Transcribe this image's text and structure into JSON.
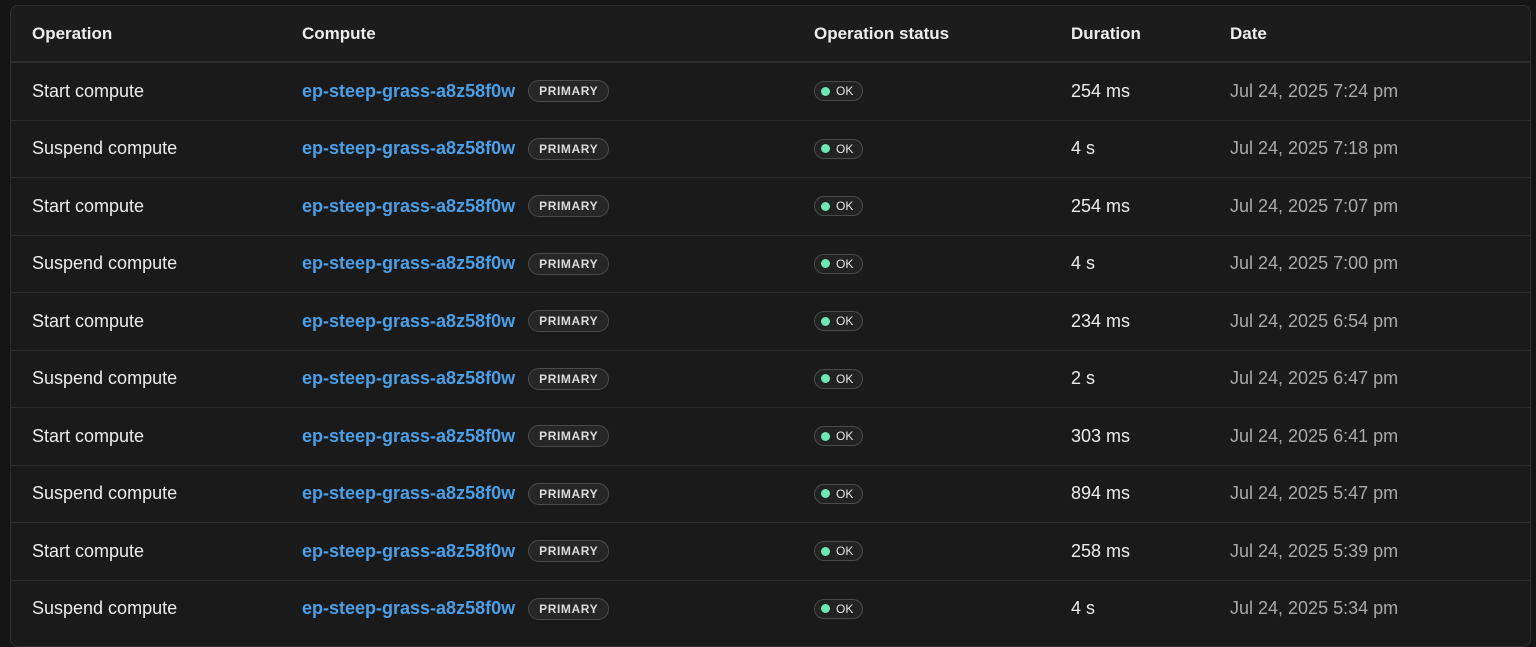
{
  "columns": {
    "operation": "Operation",
    "compute": "Compute",
    "status": "Operation status",
    "duration": "Duration",
    "date": "Date"
  },
  "colors": {
    "link": "#4b9fe8",
    "status_ok_dot": "#6ee7b7",
    "background": "#1a1a1a"
  },
  "rows": [
    {
      "operation": "Start compute",
      "compute": "ep-steep-grass-a8z58f0w",
      "badge": "PRIMARY",
      "status": "OK",
      "duration": "254 ms",
      "date": "Jul 24, 2025 7:24 pm"
    },
    {
      "operation": "Suspend compute",
      "compute": "ep-steep-grass-a8z58f0w",
      "badge": "PRIMARY",
      "status": "OK",
      "duration": "4 s",
      "date": "Jul 24, 2025 7:18 pm"
    },
    {
      "operation": "Start compute",
      "compute": "ep-steep-grass-a8z58f0w",
      "badge": "PRIMARY",
      "status": "OK",
      "duration": "254 ms",
      "date": "Jul 24, 2025 7:07 pm"
    },
    {
      "operation": "Suspend compute",
      "compute": "ep-steep-grass-a8z58f0w",
      "badge": "PRIMARY",
      "status": "OK",
      "duration": "4 s",
      "date": "Jul 24, 2025 7:00 pm"
    },
    {
      "operation": "Start compute",
      "compute": "ep-steep-grass-a8z58f0w",
      "badge": "PRIMARY",
      "status": "OK",
      "duration": "234 ms",
      "date": "Jul 24, 2025 6:54 pm"
    },
    {
      "operation": "Suspend compute",
      "compute": "ep-steep-grass-a8z58f0w",
      "badge": "PRIMARY",
      "status": "OK",
      "duration": "2 s",
      "date": "Jul 24, 2025 6:47 pm"
    },
    {
      "operation": "Start compute",
      "compute": "ep-steep-grass-a8z58f0w",
      "badge": "PRIMARY",
      "status": "OK",
      "duration": "303 ms",
      "date": "Jul 24, 2025 6:41 pm"
    },
    {
      "operation": "Suspend compute",
      "compute": "ep-steep-grass-a8z58f0w",
      "badge": "PRIMARY",
      "status": "OK",
      "duration": "894 ms",
      "date": "Jul 24, 2025 5:47 pm"
    },
    {
      "operation": "Start compute",
      "compute": "ep-steep-grass-a8z58f0w",
      "badge": "PRIMARY",
      "status": "OK",
      "duration": "258 ms",
      "date": "Jul 24, 2025 5:39 pm"
    },
    {
      "operation": "Suspend compute",
      "compute": "ep-steep-grass-a8z58f0w",
      "badge": "PRIMARY",
      "status": "OK",
      "duration": "4 s",
      "date": "Jul 24, 2025 5:34 pm"
    }
  ]
}
